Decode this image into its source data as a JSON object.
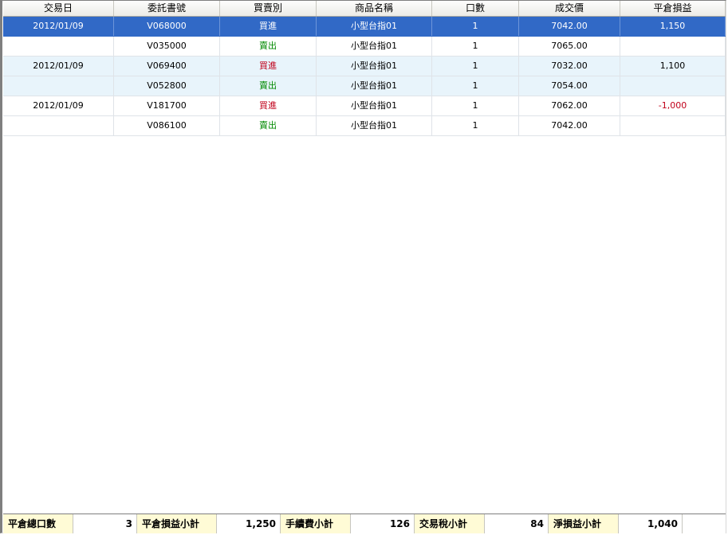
{
  "columns": [
    "交易日",
    "委託書號",
    "買賣別",
    "商品名稱",
    "口數",
    "成交價",
    "平倉損益"
  ],
  "rows": [
    {
      "date": "2012/01/09",
      "order": "V068000",
      "side": "買進",
      "side_type": "buy",
      "product": "小型台指01",
      "qty": "1",
      "price": "7042.00",
      "pnl": "1,150",
      "pnl_type": "pos"
    },
    {
      "date": "",
      "order": "V035000",
      "side": "賣出",
      "side_type": "sell",
      "product": "小型台指01",
      "qty": "1",
      "price": "7065.00",
      "pnl": "",
      "pnl_type": "pos"
    },
    {
      "date": "2012/01/09",
      "order": "V069400",
      "side": "買進",
      "side_type": "buy",
      "product": "小型台指01",
      "qty": "1",
      "price": "7032.00",
      "pnl": "1,100",
      "pnl_type": "pos"
    },
    {
      "date": "",
      "order": "V052800",
      "side": "賣出",
      "side_type": "sell",
      "product": "小型台指01",
      "qty": "1",
      "price": "7054.00",
      "pnl": "",
      "pnl_type": "pos"
    },
    {
      "date": "2012/01/09",
      "order": "V181700",
      "side": "買進",
      "side_type": "buy",
      "product": "小型台指01",
      "qty": "1",
      "price": "7062.00",
      "pnl": "-1,000",
      "pnl_type": "neg"
    },
    {
      "date": "",
      "order": "V086100",
      "side": "賣出",
      "side_type": "sell",
      "product": "小型台指01",
      "qty": "1",
      "price": "7042.00",
      "pnl": "",
      "pnl_type": "pos"
    }
  ],
  "footer": {
    "total_lots_label": "平倉總口數",
    "total_lots": "3",
    "pnl_subtotal_label": "平倉損益小計",
    "pnl_subtotal": "1,250",
    "fee_subtotal_label": "手續費小計",
    "fee_subtotal": "126",
    "tax_subtotal_label": "交易稅小計",
    "tax_subtotal": "84",
    "net_subtotal_label": "淨損益小計",
    "net_subtotal": "1,040"
  },
  "colors": {
    "selected_row": "#3169c6",
    "alt_row": "#e8f4fb",
    "buy": "#c0001a",
    "sell": "#008a00",
    "footer_label_bg": "#fffbd6"
  }
}
